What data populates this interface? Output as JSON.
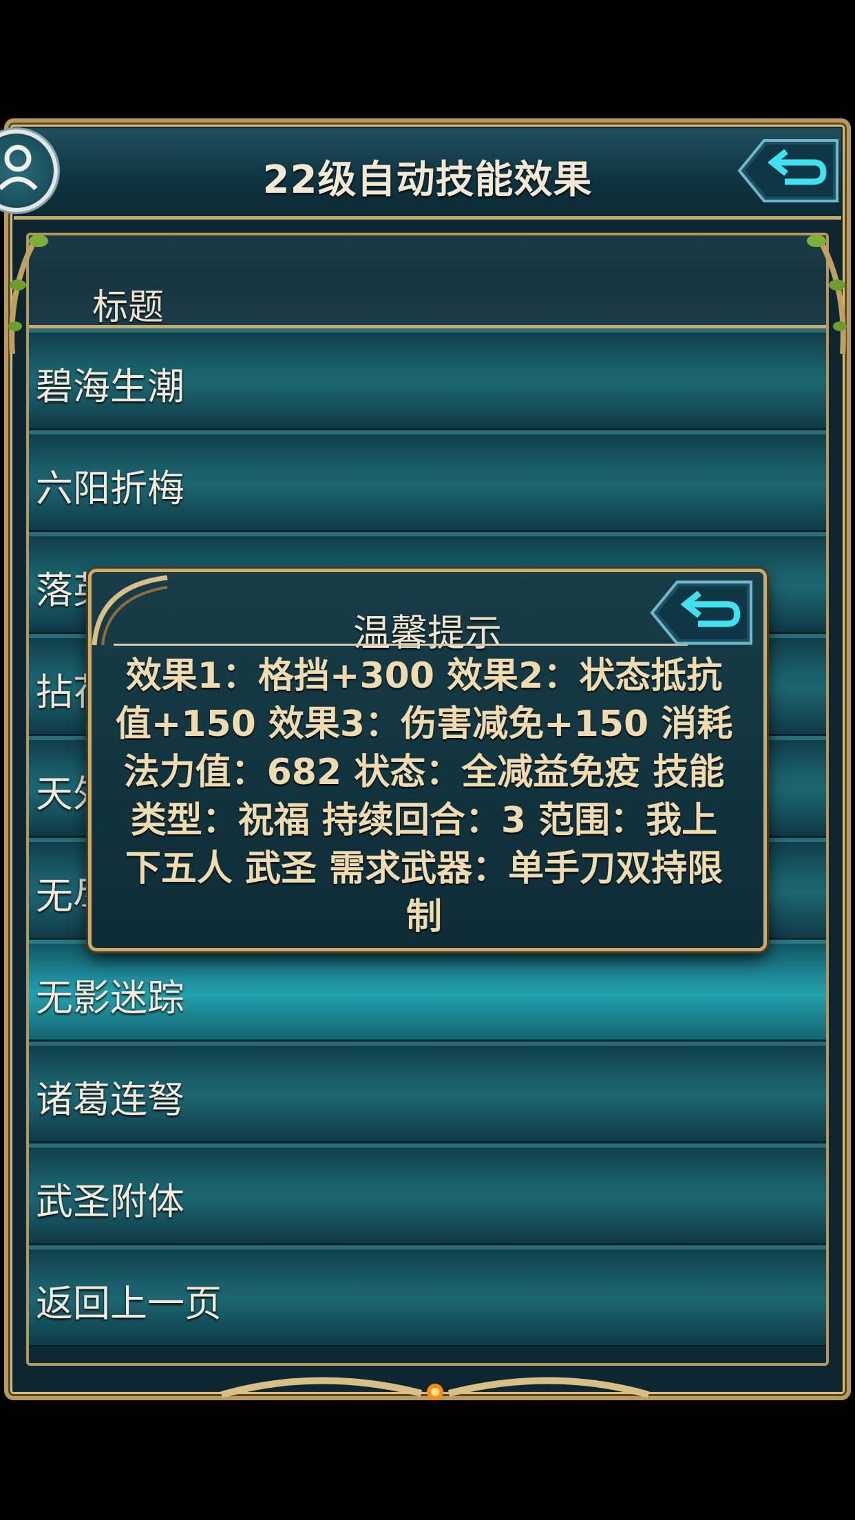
{
  "header": {
    "title": "22级自动技能效果"
  },
  "list": {
    "column_header": "标题",
    "items": [
      {
        "label": "碧海生潮"
      },
      {
        "label": "六阳折梅"
      },
      {
        "label": "落英缤纷"
      },
      {
        "label": "拈花"
      },
      {
        "label": "天外"
      },
      {
        "label": "无尽"
      },
      {
        "label": "无影迷踪"
      },
      {
        "label": "诸葛连弩"
      },
      {
        "label": "武圣附体"
      },
      {
        "label": "返回上一页"
      }
    ]
  },
  "dialog": {
    "title": "温馨提示",
    "body": "效果1：格挡+300 效果2：状态抵抗值+150 效果3：伤害减免+150 消耗法力值：682 状态：全减益免疫 技能类型：祝福 持续回合：3 范围：我上下五人 武圣 需求武器：单手刀双持限制"
  },
  "icons": {
    "back": "back-arrow-icon",
    "avatar": "user-icon"
  },
  "colors": {
    "frame_gold": "#c8aa6b",
    "panel_teal": "#1c6571",
    "active_row": "#24a0ad",
    "dialog_text": "#eedcb0",
    "back_button_cyan": "#3fe3f0"
  }
}
